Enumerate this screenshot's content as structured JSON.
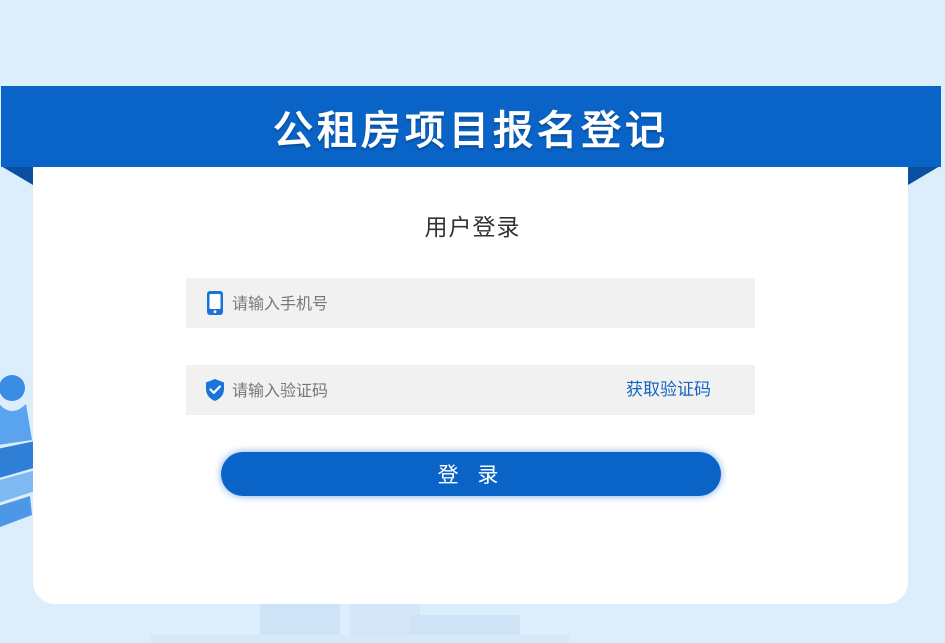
{
  "banner": {
    "title": "公租房项目报名登记"
  },
  "login": {
    "title": "用户登录",
    "phone": {
      "placeholder": "请输入手机号",
      "value": "",
      "icon": "mobile-phone-icon"
    },
    "code": {
      "placeholder": "请输入验证码",
      "value": "",
      "icon": "shield-check-icon",
      "get_code_label": "获取验证码"
    },
    "submit_label": "登 录"
  },
  "colors": {
    "page_background": "#dcedfb",
    "brand_blue": "#0a64c8",
    "ribbon_fold": "#0b4fa1",
    "input_background": "#f1f1f1",
    "link_blue": "#1565c0"
  }
}
